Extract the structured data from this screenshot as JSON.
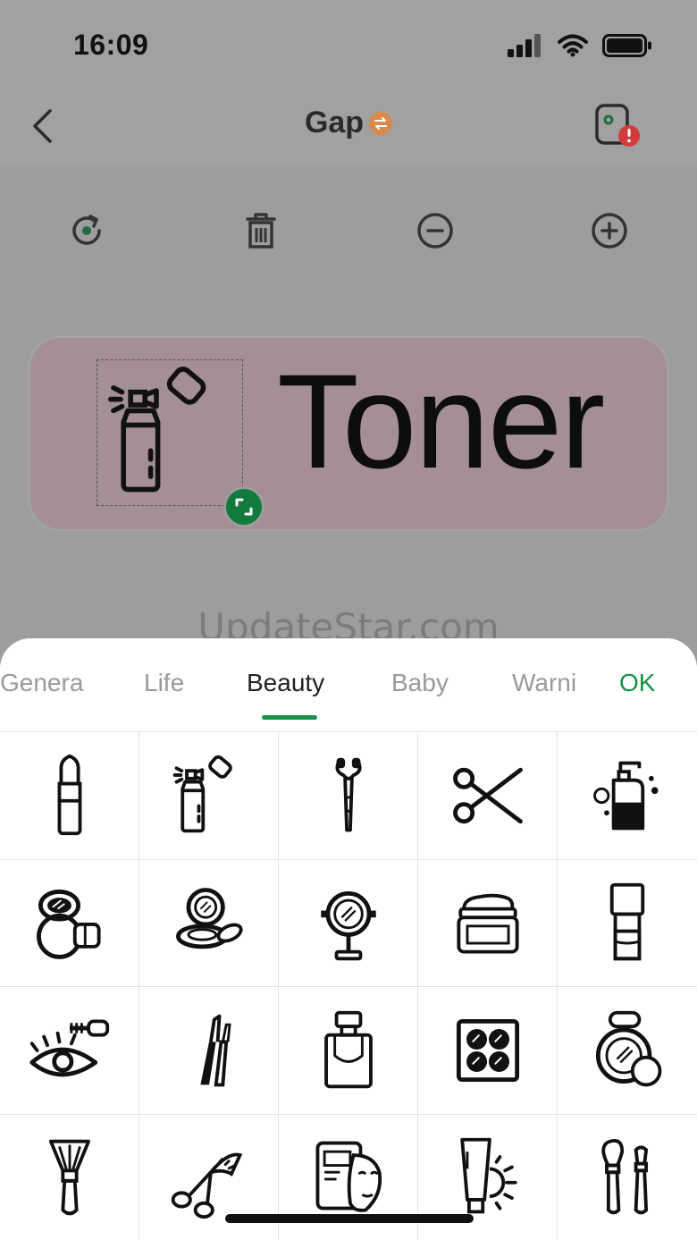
{
  "status": {
    "time": "16:09"
  },
  "nav": {
    "title": "Gap"
  },
  "label": {
    "text": "Toner"
  },
  "watermark": "UpdateStar.com",
  "tabs": [
    {
      "label": "Genera",
      "active": false
    },
    {
      "label": "Life",
      "active": false
    },
    {
      "label": "Beauty",
      "active": true
    },
    {
      "label": "Baby",
      "active": false
    },
    {
      "label": "Warni",
      "active": false
    }
  ],
  "ok_label": "OK",
  "icons": [
    "lipstick-icon",
    "toner-spray-icon",
    "eyelash-curler-brush-icon",
    "scissors-icon",
    "soap-dispenser-icon",
    "compact-mirror-icon",
    "powder-compact-icon",
    "vanity-mirror-icon",
    "cream-jar-icon",
    "nail-polish-icon",
    "eye-mascara-icon",
    "eyeliner-icon",
    "perfume-bottle-icon",
    "eyeshadow-palette-icon",
    "powder-puff-icon",
    "makeup-brush-icon",
    "eyelash-curler-icon",
    "face-mask-icon",
    "sunscreen-icon",
    "makeup-brushes-icon"
  ],
  "colors": {
    "accent": "#14934a",
    "label_bg": "#a48e97",
    "overlay": "#9d9d9d"
  }
}
